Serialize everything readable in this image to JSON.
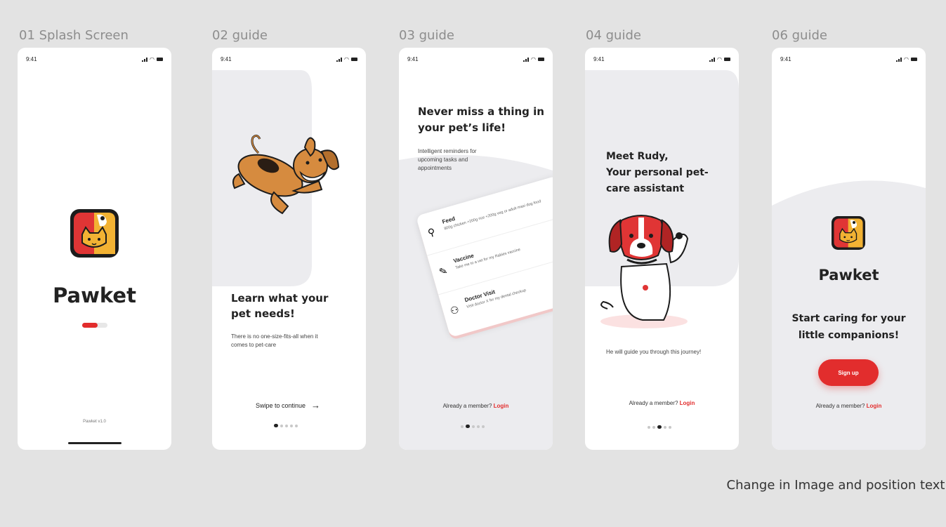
{
  "frames": [
    {
      "title": "01 Splash Screen",
      "time": "9:41",
      "app_name": "Pawket",
      "version": "Pawket v1.0",
      "progress": 0.6
    },
    {
      "title": "02 guide",
      "time": "9:41",
      "heading": "Learn what your pet needs!",
      "body": "There is no one-size-fits-all when it comes to pet-care",
      "swipe_label": "Swipe to continue",
      "active_page": 1
    },
    {
      "title": "03 guide",
      "time": "9:41",
      "heading": "Never miss a thing in your pet’s life!",
      "body": "Intelligent reminders for upcoming tasks and appointments",
      "reminders": [
        {
          "title": "Feed",
          "desc": "800g chicken +200g rice +200g veg or adult maxi dog food",
          "icon": "bone-icon"
        },
        {
          "title": "Vaccine",
          "desc": "Take me to a vet for my Rabies vaccine",
          "icon": "syringe-icon"
        },
        {
          "title": "Doctor Visit",
          "desc": "Visit doctor X for my dental checkup",
          "icon": "doctor-icon"
        }
      ],
      "login_prompt": "Already a member?",
      "login_label": "Login",
      "active_page": 2
    },
    {
      "title": "04 guide",
      "time": "9:41",
      "heading_line1": "Meet Rudy,",
      "heading_line2": "Your personal pet-care assistant",
      "body": "He will guide you through this journey!",
      "login_prompt": "Already a member?",
      "login_label": "Login",
      "active_page": 3
    },
    {
      "title": "06 guide",
      "time": "9:41",
      "app_name": "Pawket",
      "tagline": "Start caring for your little companions!",
      "signup_label": "Sign up",
      "login_prompt": "Already a member?",
      "login_label": "Login"
    }
  ],
  "annotation": "Change in Image and position text",
  "colors": {
    "accent": "#e22d2d",
    "brand_yellow": "#f2b233",
    "bg_grey": "#ececef"
  }
}
